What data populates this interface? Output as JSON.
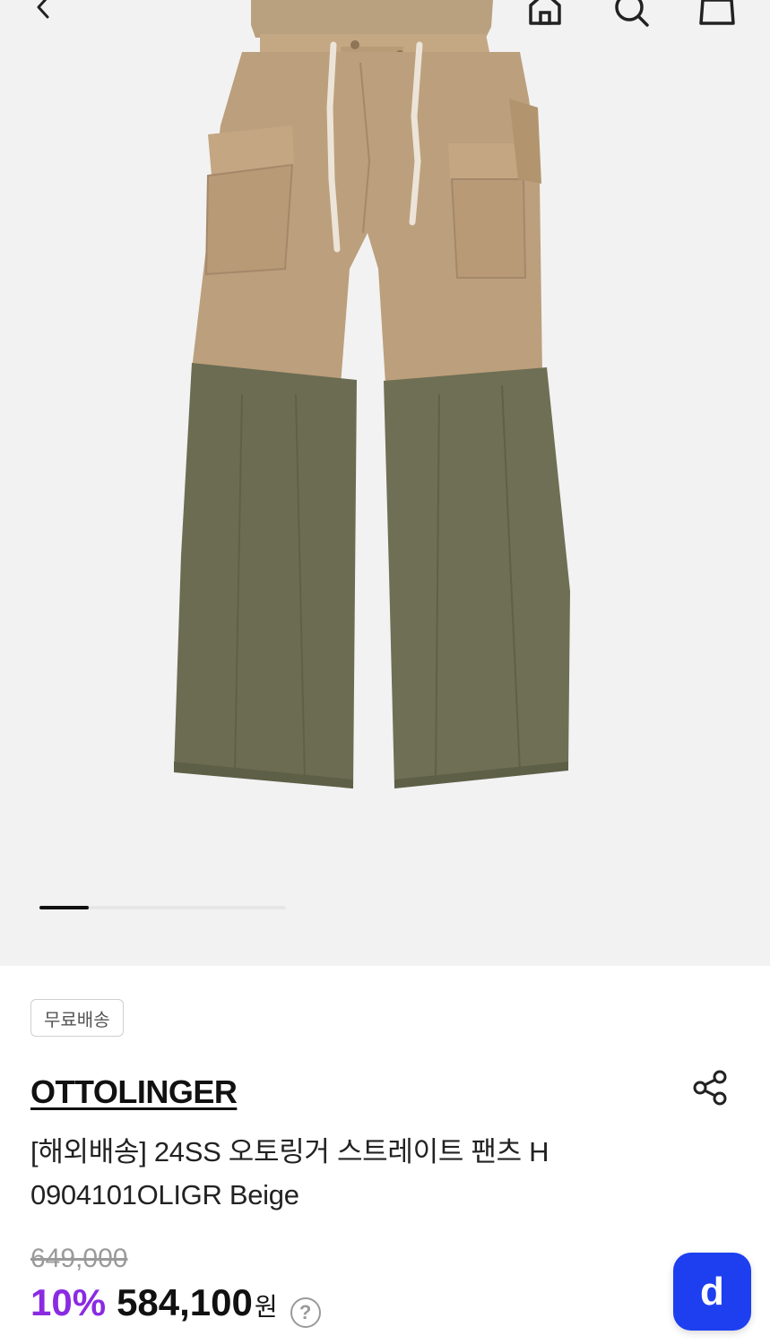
{
  "header": {
    "back_icon": "chevron-left-icon",
    "home_icon": "home-icon",
    "search_icon": "search-icon",
    "cart_icon": "shopping-bag-icon"
  },
  "gallery": {
    "image_alt": "product photo: wide-leg cargo pants, beige top with olive green linen lower legs",
    "current_index": 1,
    "total": 5
  },
  "product": {
    "badge": "무료배송",
    "brand": "OTTOLINGER",
    "title": "[해외배송] 24SS 오토링거 스트레이트 팬츠 H 0904101OLIGR Beige",
    "original_price": "649,000",
    "discount": "10%",
    "price": "584,100",
    "currency": "원",
    "help_symbol": "?"
  },
  "floating_button": {
    "label": "d"
  },
  "colors": {
    "accent_discount": "#8a2be2",
    "floating_button": "#1e3ff0",
    "hero_bg": "#f2f2f2"
  }
}
